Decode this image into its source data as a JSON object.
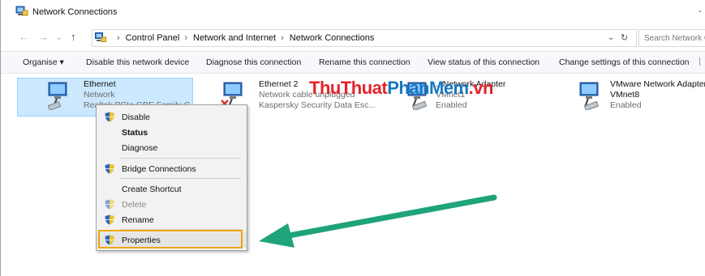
{
  "window": {
    "title": "Network Connections",
    "title_control": "-"
  },
  "address": {
    "back": "←",
    "forward": "→",
    "recent": "⌄",
    "up": "↑",
    "crumbs": [
      "Control Panel",
      "Network and Internet",
      "Network Connections"
    ],
    "separator": "›",
    "dropdown": "⌄",
    "refresh": "↻",
    "search_placeholder": "Search Network C"
  },
  "commands": {
    "organise": "Organise ▾",
    "disable": "Disable this network device",
    "diagnose": "Diagnose this connection",
    "rename": "Rename this connection",
    "view_status": "View status of this connection",
    "change_settings": "Change settings of this connection"
  },
  "items": [
    {
      "name": "Ethernet",
      "line2": "Network",
      "line3": "Realtek PCIe GBE Family C..."
    },
    {
      "name": "Ethernet 2",
      "line2": "Network cable unplugged",
      "line3": "Kaspersky Security Data Esc..."
    },
    {
      "name": "...Network Adapter",
      "line2": "VMnet1",
      "line3": "Enabled"
    },
    {
      "name": "VMware Network Adapter",
      "line2": "VMnet8",
      "line3": "Enabled"
    }
  ],
  "watermark": {
    "part1": "ThuThuat",
    "part2": "PhanMem",
    "part3": ".vn"
  },
  "context_menu": {
    "disable": "Disable",
    "status": "Status",
    "diagnose": "Diagnose",
    "bridge": "Bridge Connections",
    "shortcut": "Create Shortcut",
    "delete": "Delete",
    "rename": "Rename",
    "properties": "Properties"
  },
  "colors": {
    "selection_bg": "#cce8ff",
    "highlight_border": "#f0a500",
    "arrow": "#1fa37a",
    "watermark_red": "#e4242b",
    "watermark_blue": "#1778c0"
  }
}
